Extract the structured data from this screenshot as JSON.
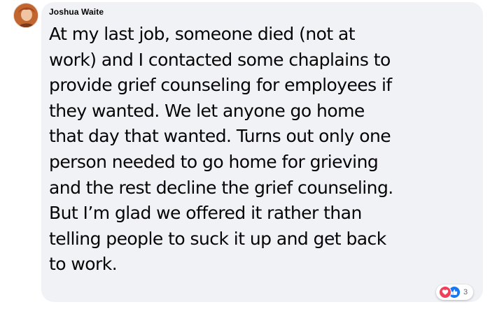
{
  "comment": {
    "author": "Joshua Waite",
    "text_lines": [
      "At my last job, someone died (not at",
      "work) and I contacted some chaplains to",
      "provide grief counseling for employees if",
      "they wanted. We let anyone go home",
      "that day that wanted. Turns out only one",
      "person needed to go home for grieving",
      "and the rest decline the grief counseling.",
      "But I’m glad we offered it rather than",
      "telling people to suck it up and get back",
      "to work."
    ],
    "reactions": {
      "icons": [
        "love-icon",
        "like-icon"
      ],
      "count": "3"
    }
  },
  "colors": {
    "bubble_bg": "#f0f2f5",
    "text": "#050505",
    "love": "#f33e58",
    "like": "#1877f2",
    "count_text": "#65676b"
  }
}
